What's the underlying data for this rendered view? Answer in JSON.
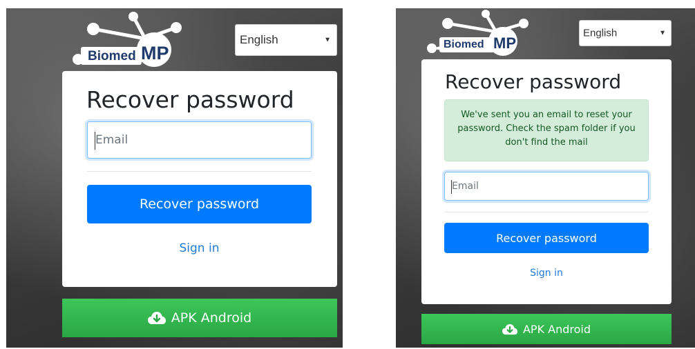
{
  "screens": [
    {
      "logo": {
        "text_left": "Biomed",
        "text_right": "MP"
      },
      "language": {
        "selected": "English"
      },
      "card": {
        "title": "Recover password",
        "email_placeholder": "Email",
        "submit_label": "Recover password",
        "signin_label": "Sign in"
      },
      "apk_label": "APK Android"
    },
    {
      "logo": {
        "text_left": "Biomed",
        "text_right": "MP"
      },
      "language": {
        "selected": "English"
      },
      "card": {
        "title": "Recover password",
        "alert": "We've sent you an email to reset your password. Check the spam folder if you don't find the mail",
        "email_placeholder": "Email",
        "submit_label": "Recover password",
        "signin_label": "Sign in"
      },
      "apk_label": "APK Android"
    }
  ],
  "colors": {
    "primary": "#007bff",
    "success": "#28a745",
    "link": "#1e7ad6",
    "alert_bg": "#d4edda",
    "alert_text": "#155724",
    "logo_text": "#1f3b6b"
  },
  "icons": {
    "download": "cloud-download-icon",
    "caret": "caret-down-icon"
  }
}
